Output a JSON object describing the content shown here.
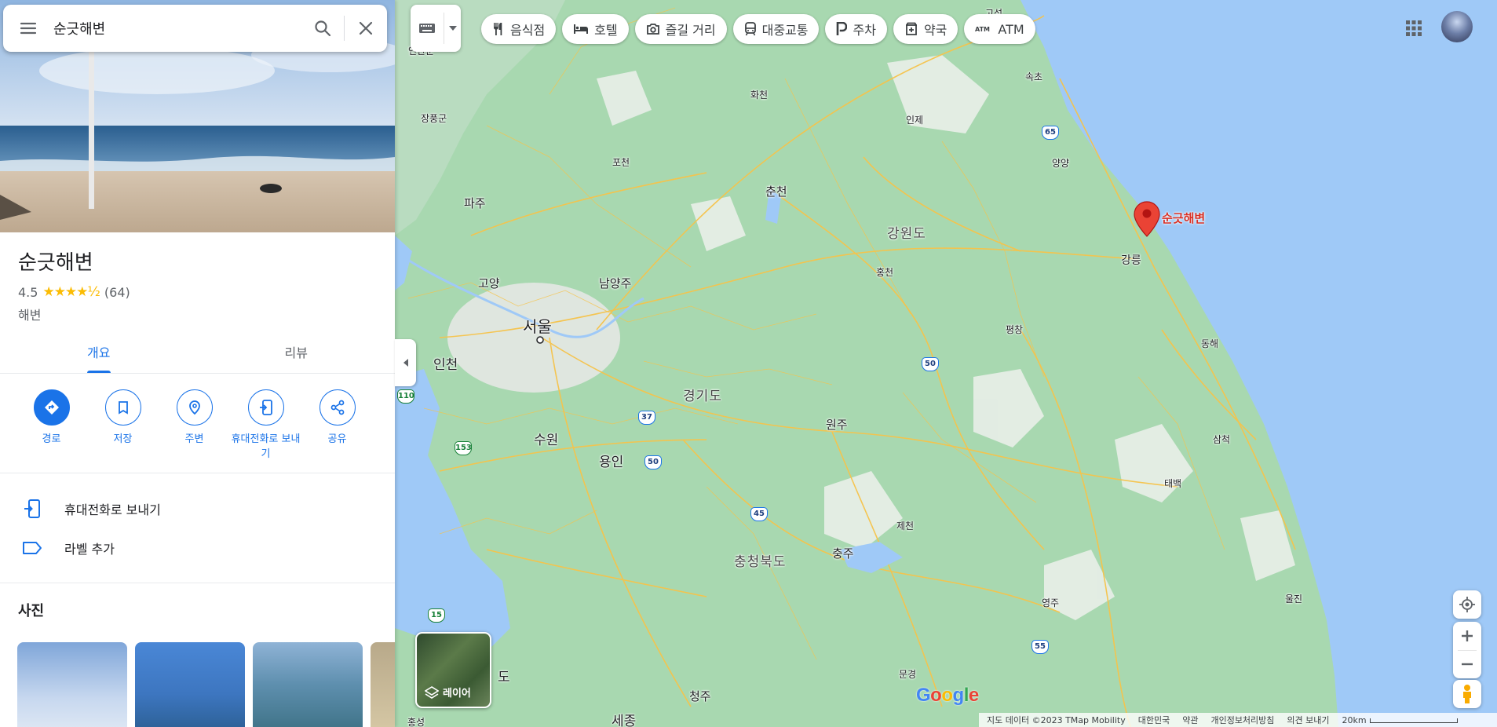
{
  "search": {
    "query": "순긋해변"
  },
  "place": {
    "title": "순긋해변",
    "rating": "4.5",
    "stars": "★★★★½",
    "review_count": "(64)",
    "category": "해변"
  },
  "tabs": [
    {
      "label": "개요",
      "active": true
    },
    {
      "label": "리뷰",
      "active": false
    }
  ],
  "actions": [
    {
      "label": "경로",
      "icon": "directions-icon"
    },
    {
      "label": "저장",
      "icon": "bookmark-icon"
    },
    {
      "label": "주변",
      "icon": "nearby-icon"
    },
    {
      "label": "휴대전화로 보내기",
      "icon": "send-to-phone-icon"
    },
    {
      "label": "공유",
      "icon": "share-icon"
    }
  ],
  "list_items": [
    {
      "label": "휴대전화로 보내기",
      "icon": "send-to-phone-icon"
    },
    {
      "label": "라벨 추가",
      "icon": "label-icon"
    }
  ],
  "photos": {
    "title": "사진"
  },
  "chips": [
    {
      "label": "음식점",
      "icon": "restaurant-icon"
    },
    {
      "label": "호텔",
      "icon": "hotel-icon"
    },
    {
      "label": "즐길 거리",
      "icon": "camera-icon"
    },
    {
      "label": "대중교통",
      "icon": "transit-icon"
    },
    {
      "label": "주차",
      "icon": "parking-icon"
    },
    {
      "label": "약국",
      "icon": "pharmacy-icon"
    },
    {
      "label": "ATM",
      "icon": "atm-icon"
    }
  ],
  "pin": {
    "label": "순긋해변"
  },
  "layers": {
    "label": "레이어"
  },
  "map_labels": {
    "seoul": "서울",
    "incheon": "인천",
    "suwon": "수원",
    "yongin": "용인",
    "goyang": "고양",
    "paju": "파주",
    "namyangju": "남양주",
    "chuncheon": "춘천",
    "gyeonggi": "경기도",
    "gangwon": "강원도",
    "wonju": "원주",
    "chungju": "충주",
    "chungbuk": "충청북도",
    "cheongju": "청주",
    "sejong": "세종",
    "jecheon": "제천",
    "gangneung": "강릉",
    "donghae": "동해",
    "samcheok": "삼척",
    "taebaek": "태백",
    "yeongju": "영주",
    "uljin": "울진",
    "mungyeong": "문경",
    "pyeongchang": "평창",
    "hongcheon": "홍천",
    "inje": "인제",
    "yangyang": "양양",
    "sokcho": "속초",
    "hwacheon": "화천",
    "pocheon": "포천",
    "jangpung": "장풍군",
    "goseong": "고성",
    "hongseong": "홍성",
    "do": "도",
    "yeonan": "연안군"
  },
  "shields": [
    "65",
    "50",
    "37",
    "50",
    "110",
    "153",
    "45",
    "15",
    "55"
  ],
  "footer": {
    "data": "지도 데이터 ©2023 TMap Mobility",
    "country": "대한민국",
    "terms": "약관",
    "privacy": "개인정보처리방침",
    "feedback": "의견 보내기",
    "scale": "20km"
  },
  "colors": {
    "accent": "#1a73e8",
    "pin": "#d93025",
    "land": "#a8d8b0",
    "water": "#9fc9f7",
    "roads": "#f6c34a"
  }
}
